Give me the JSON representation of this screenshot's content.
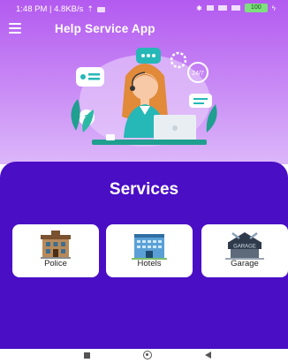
{
  "status_bar": {
    "time_speed": "1:48 PM | 4.8KB/s",
    "battery": "100"
  },
  "app_bar": {
    "title": "Help Service App",
    "menu_icon": "hamburger-menu-icon"
  },
  "illustration": {
    "icon": "customer-support-agent-illustration",
    "badge_text": "24/7"
  },
  "services": {
    "title": "Services",
    "items": [
      {
        "label": "Police",
        "icon": "police-station-icon"
      },
      {
        "label": "Hotels",
        "icon": "hotel-building-icon"
      },
      {
        "label": "Garage",
        "icon": "garage-icon",
        "sign_text": "GARAGE"
      }
    ]
  },
  "nav_bar": {
    "icons": [
      "recents-icon",
      "home-icon",
      "back-icon"
    ]
  },
  "colors": {
    "header_top": "#b35af0",
    "header_bottom": "#dcb7fa",
    "panel": "#4a0ec5",
    "card": "#ffffff"
  }
}
